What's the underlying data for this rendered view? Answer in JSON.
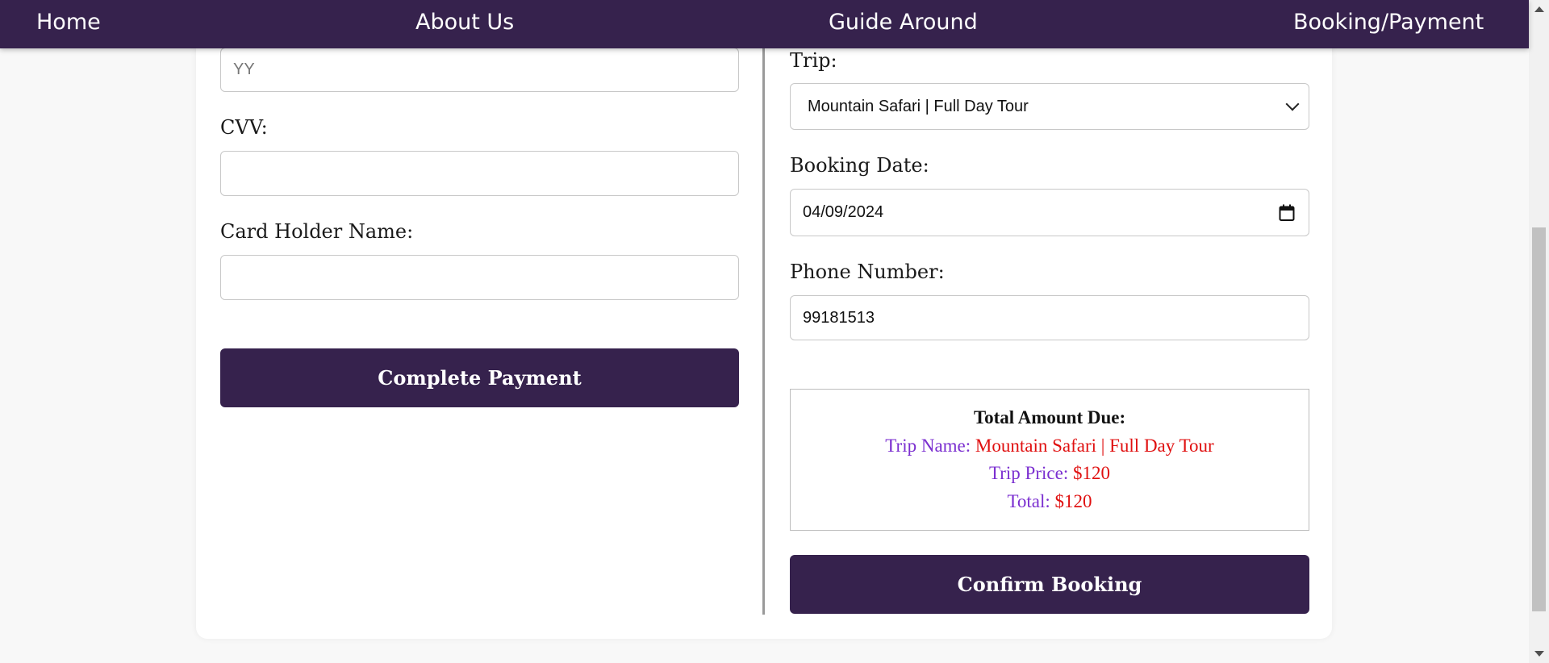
{
  "nav": {
    "home": "Home",
    "about": "About Us",
    "guide": "Guide Around",
    "booking": "Booking/Payment"
  },
  "payment": {
    "year_placeholder": "YY",
    "cvv_label": "CVV:",
    "cvv_value": "",
    "holder_label": "Card Holder Name:",
    "holder_value": "",
    "complete_button": "Complete Payment"
  },
  "booking": {
    "trip_label": "Trip:",
    "trip_selected": "Mountain Safari | Full Day Tour",
    "date_label": "Booking Date:",
    "date_value": "04/09/2024",
    "phone_label": "Phone Number:",
    "phone_value": "99181513",
    "confirm_button": "Confirm Booking"
  },
  "summary": {
    "title": "Total Amount Due:",
    "trip_name_label": "Trip Name:",
    "trip_name_value": "Mountain Safari | Full Day Tour",
    "trip_price_label": "Trip Price:",
    "trip_price_value": "$120",
    "total_label": "Total:",
    "total_value": "$120"
  },
  "colors": {
    "brand": "#36224d",
    "summary_key": "#7b2fd0",
    "summary_value": "#e01010"
  },
  "icons": {
    "select": "chevron-down-icon",
    "date": "calendar-icon"
  }
}
